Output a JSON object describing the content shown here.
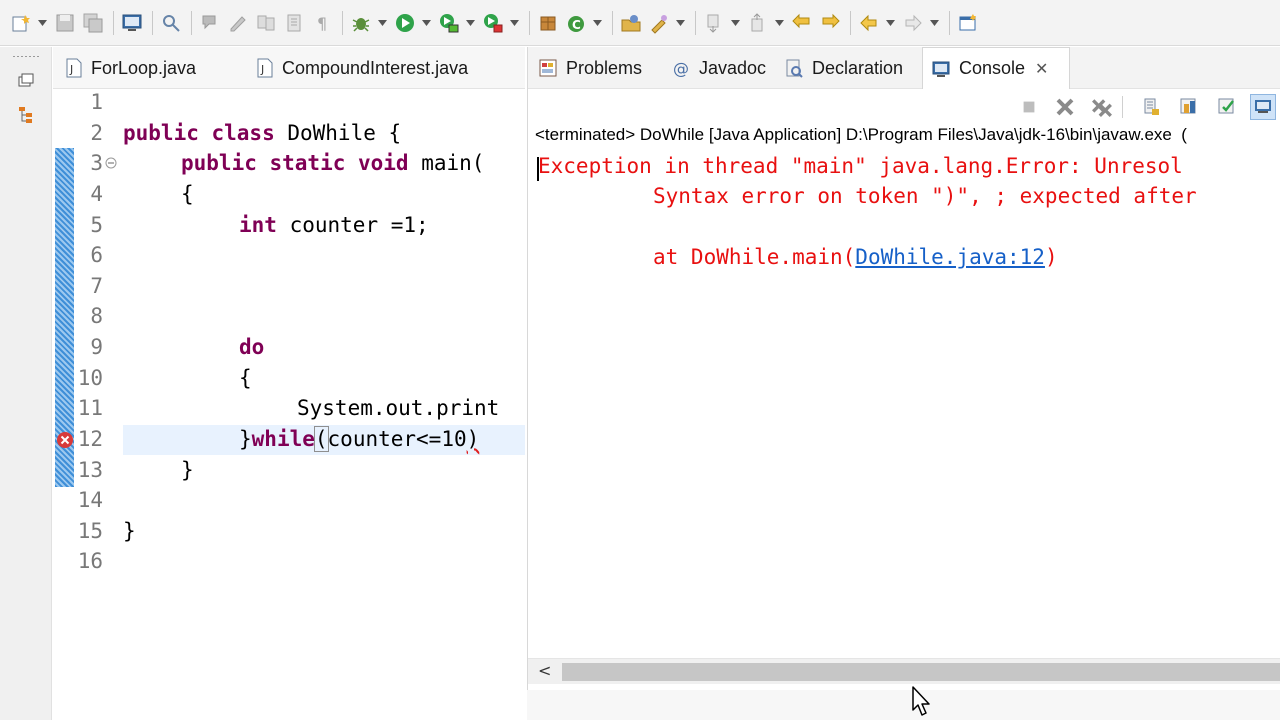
{
  "editor": {
    "tabs": [
      {
        "label": "ForLoop.java"
      },
      {
        "label": "CompoundInterest.java"
      }
    ],
    "lines": [
      {
        "no": "1"
      },
      {
        "no": "2"
      },
      {
        "no": "3"
      },
      {
        "no": "4"
      },
      {
        "no": "5"
      },
      {
        "no": "6"
      },
      {
        "no": "7"
      },
      {
        "no": "8"
      },
      {
        "no": "9"
      },
      {
        "no": "10"
      },
      {
        "no": "11"
      },
      {
        "no": "12"
      },
      {
        "no": "13"
      },
      {
        "no": "14"
      },
      {
        "no": "15"
      },
      {
        "no": "16"
      }
    ],
    "code": {
      "l2_kw": "public class",
      "l2_rest": " DoWhile {",
      "l3_kw": "public static void",
      "l3_rest": " main(",
      "l4": "{",
      "l5_kw": "int",
      "l5_rest": " counter =1;",
      "l9_kw": "do",
      "l10": "{",
      "l11": "System.out.print",
      "l12_a": "}",
      "l12_kw": "while",
      "l12_paren": "(",
      "l12_rest": "counter<=10",
      "l12_close": ")",
      "l13": "}",
      "l15": "}"
    }
  },
  "console": {
    "tabs": [
      {
        "label": "Problems",
        "icon": "problems-icon"
      },
      {
        "label": "Javadoc",
        "icon": "at-icon"
      },
      {
        "label": "Declaration",
        "icon": "declaration-icon"
      },
      {
        "label": "Console",
        "icon": "console-icon"
      }
    ],
    "status": "<terminated> DoWhile [Java Application] D:\\Program Files\\Java\\jdk-16\\bin\\javaw.exe  (",
    "output": {
      "line1": "Exception in thread \"main\" java.lang.Error: Unresol",
      "line2": "Syntax error on token \")\", ; expected after",
      "line3_prefix": "at DoWhile.main(",
      "line3_link": "DoWhile.java:12",
      "line3_suffix": ")"
    },
    "scroll_arrow": "<"
  },
  "colors": {
    "keyword": "#7f0055",
    "error_text": "#e81010",
    "link": "#1660c8",
    "current_line": "#e8f2fe"
  }
}
